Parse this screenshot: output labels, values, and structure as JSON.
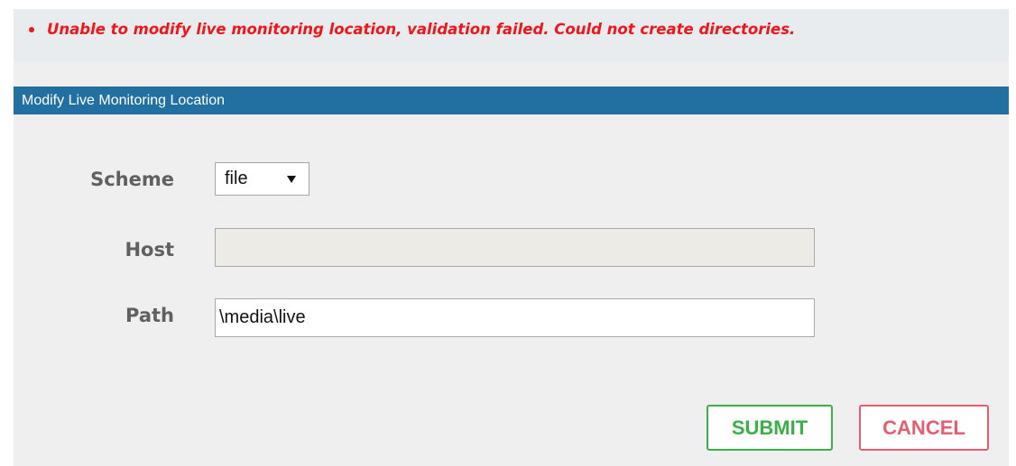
{
  "error": {
    "message": "Unable to modify live monitoring location, validation failed. Could not create directories."
  },
  "panel": {
    "title": "Modify Live Monitoring Location"
  },
  "form": {
    "scheme_label": "Scheme",
    "scheme_value": "file",
    "host_label": "Host",
    "host_value": "",
    "path_label": "Path",
    "path_value": "\\media\\live"
  },
  "buttons": {
    "submit_label": "SUBMIT",
    "cancel_label": "CANCEL"
  },
  "colors": {
    "error_text": "#f0151a",
    "header_bg": "#2270a1",
    "submit_accent": "#3bb046",
    "cancel_accent": "#e45e70"
  }
}
